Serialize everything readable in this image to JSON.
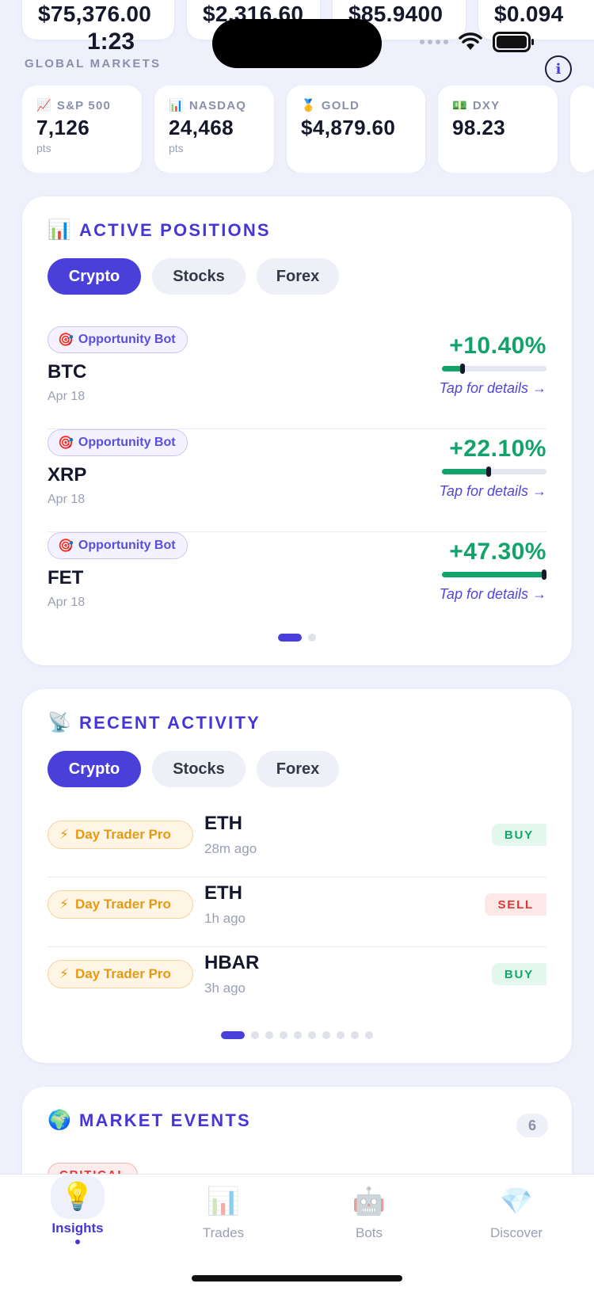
{
  "top_prices": [
    "$75,376.00",
    "$2,316.60",
    "$85.9400",
    "$0.094"
  ],
  "status": {
    "time": "1:23"
  },
  "global_markets": {
    "title": "GLOBAL MARKETS",
    "info_icon": "i",
    "items": [
      {
        "icon": "📈",
        "label": "S&P 500",
        "value": "7,126",
        "unit": "pts"
      },
      {
        "icon": "📊",
        "label": "NASDAQ",
        "value": "24,468",
        "unit": "pts"
      },
      {
        "icon": "🥇",
        "label": "GOLD",
        "value": "$4,879.60",
        "unit": ""
      },
      {
        "icon": "💵",
        "label": "DXY",
        "value": "98.23",
        "unit": ""
      }
    ]
  },
  "active_positions": {
    "icon": "📊",
    "title": "ACTIVE POSITIONS",
    "tabs": [
      "Crypto",
      "Stocks",
      "Forex"
    ],
    "active_tab": 0,
    "rows": [
      {
        "bot": "Opportunity Bot",
        "bot_icon": "🎯",
        "symbol": "BTC",
        "date": "Apr 18",
        "pct": "+10.40%",
        "progress": 0.22,
        "tap": "Tap for details →"
      },
      {
        "bot": "Opportunity Bot",
        "bot_icon": "🎯",
        "symbol": "XRP",
        "date": "Apr 18",
        "pct": "+22.10%",
        "progress": 0.47,
        "tap": "Tap for details →"
      },
      {
        "bot": "Opportunity Bot",
        "bot_icon": "🎯",
        "symbol": "FET",
        "date": "Apr 18",
        "pct": "+47.30%",
        "progress": 1.0,
        "tap": "Tap for details →"
      }
    ],
    "pages": 2,
    "current_page": 0
  },
  "recent_activity": {
    "icon": "📡",
    "title": "RECENT ACTIVITY",
    "tabs": [
      "Crypto",
      "Stocks",
      "Forex"
    ],
    "active_tab": 0,
    "rows": [
      {
        "bot": "Day Trader Pro",
        "bot_icon": "⚡",
        "symbol": "ETH",
        "time": "28m ago",
        "action": "BUY"
      },
      {
        "bot": "Day Trader Pro",
        "bot_icon": "⚡",
        "symbol": "ETH",
        "time": "1h ago",
        "action": "SELL"
      },
      {
        "bot": "Day Trader Pro",
        "bot_icon": "⚡",
        "symbol": "HBAR",
        "time": "3h ago",
        "action": "BUY"
      }
    ],
    "pages": 10,
    "current_page": 0
  },
  "market_events": {
    "icon": "🌍",
    "title": "MARKET EVENTS",
    "count": "6",
    "first_tag": "CRITICAL"
  },
  "tabbar": [
    {
      "icon": "💡",
      "label": "Insights",
      "active": true
    },
    {
      "icon": "📊",
      "label": "Trades",
      "active": false
    },
    {
      "icon": "🤖",
      "label": "Bots",
      "active": false
    },
    {
      "icon": "💎",
      "label": "Discover",
      "active": false
    }
  ],
  "colors": {
    "accent": "#4a3fd9",
    "positive": "#12a36b",
    "sell": "#e23535",
    "bot_orange": "#e59a17"
  }
}
